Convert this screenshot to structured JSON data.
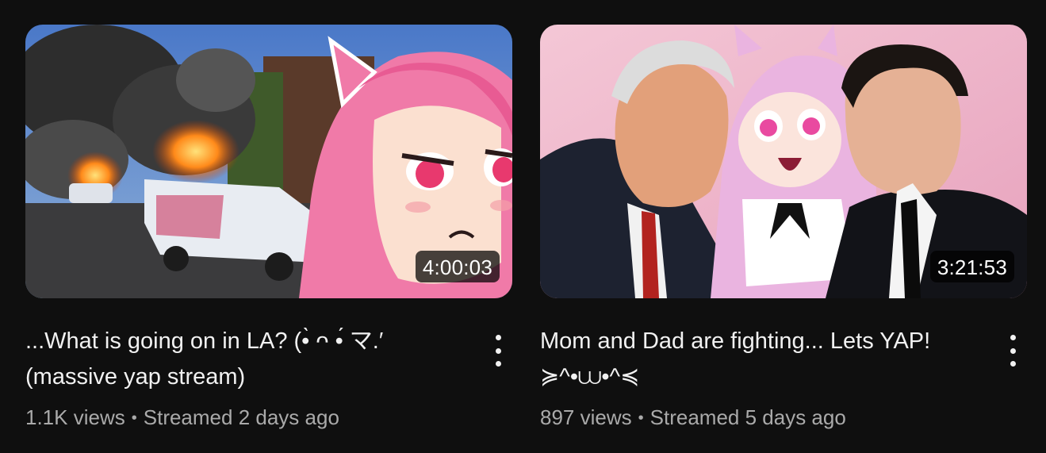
{
  "videos": [
    {
      "duration": "4:00:03",
      "title_line1": "...What is going on in LA? (•̀ ᴖ •́ マ.′",
      "title_line2": "(massive yap stream)",
      "views": "1.1K views",
      "separator": "•",
      "age": "Streamed 2 days ago",
      "menu_icon": "more-vert-icon"
    },
    {
      "duration": "3:21:53",
      "title_line1": "Mom and Dad are fighting... Lets YAP!",
      "title_line2": "≽^•⩊•^≼",
      "views": "897 views",
      "separator": "•",
      "age": "Streamed 5 days ago",
      "menu_icon": "more-vert-icon"
    }
  ],
  "colors": {
    "background": "#0f0f0f",
    "title": "#f1f1f1",
    "meta": "#aaaaaa"
  }
}
